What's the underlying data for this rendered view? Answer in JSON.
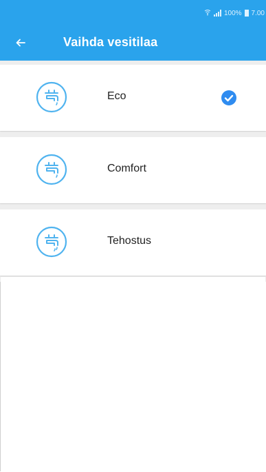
{
  "colors": {
    "accent": "#2aa3ec",
    "icon": "#4fb3ef",
    "check": "#2f8cf0"
  },
  "status_bar": {
    "battery": "100%",
    "time": "7.00"
  },
  "app_bar": {
    "title": "Vaihda vesitilaa",
    "back_icon": "arrow-left-icon"
  },
  "modes": [
    {
      "label": "Eco",
      "icon": "faucet-icon",
      "selected": true
    },
    {
      "label": "Comfort",
      "icon": "faucet-icon",
      "selected": false
    },
    {
      "label": "Tehostus",
      "icon": "faucet-icon",
      "selected": false
    }
  ]
}
